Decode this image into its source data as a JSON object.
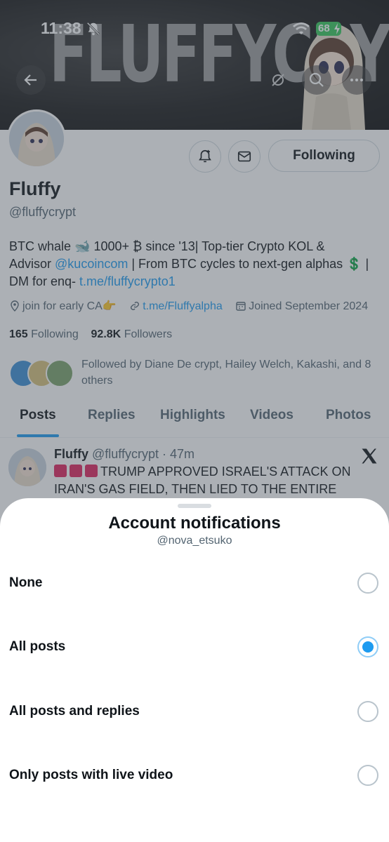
{
  "status_bar": {
    "time": "11:38",
    "battery": "68"
  },
  "banner": {
    "text": "FLUFFYCRYP"
  },
  "profile": {
    "following_button": "Following",
    "name": "Fluffy",
    "handle": "@fluffycrypt",
    "bio": {
      "line1": "BTC whale 🐋 1000+ ₿ since '13| Top-tier Crypto KOL &",
      "line2_prefix": "Advisor ",
      "line2_link": "@kucoincom",
      "line2_suffix": " | From BTC cycles to next-gen alphas 💲 |",
      "line3_prefix": "DM for enq- ",
      "line3_link": "t.me/fluffycrypto1"
    },
    "location": "join for early CA👉",
    "website": "t.me/Fluffyalpha",
    "joined": "Joined September 2024",
    "following_count": "165",
    "following_label": "Following",
    "followers_count": "92.8K",
    "followers_label": "Followers",
    "followed_by": "Followed by Diane De crypt, Hailey Welch, Kakashi, and 8 others"
  },
  "tabs": [
    {
      "label": "Posts"
    },
    {
      "label": "Replies"
    },
    {
      "label": "Highlights"
    },
    {
      "label": "Videos"
    },
    {
      "label": "Photos"
    }
  ],
  "tweet": {
    "author": "Fluffy",
    "handle_time": "@fluffycrypt · 47m",
    "line1": "TRUMP APPROVED ISRAEL'S ATTACK ON",
    "line2": "IRAN'S GAS FIELD, THEN LIED TO THE ENTIRE WORLD"
  },
  "sheet": {
    "title": "Account notifications",
    "subtitle": "@nova_etsuko",
    "options": [
      {
        "label": "None",
        "selected": false
      },
      {
        "label": "All posts",
        "selected": true
      },
      {
        "label": "All posts and replies",
        "selected": false
      },
      {
        "label": "Only posts with live video",
        "selected": false
      }
    ]
  },
  "colors": {
    "accent": "#1d9bf0",
    "battery": "#35c759"
  }
}
